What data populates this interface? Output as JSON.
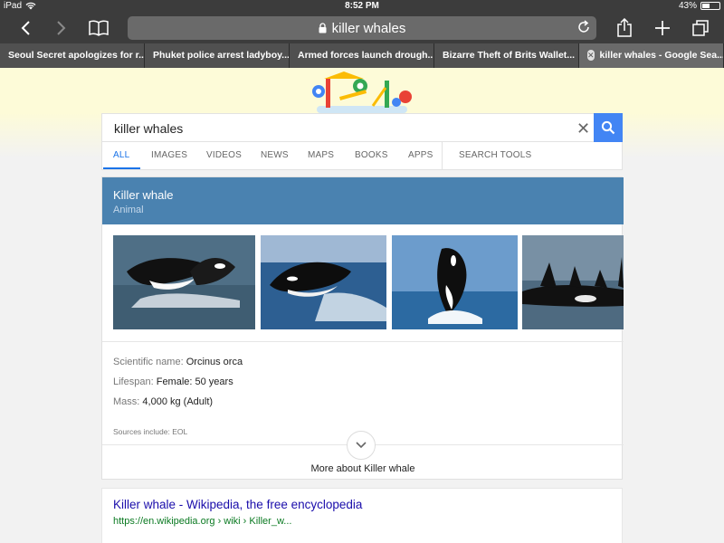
{
  "status": {
    "device": "iPad",
    "time": "8:52 PM",
    "battery": "43%",
    "battery_level": 0.43
  },
  "toolbar": {
    "url_text": "killer whales",
    "icons": [
      "back-icon",
      "forward-icon",
      "bookmarks-icon",
      "lock-icon",
      "reload-icon",
      "share-icon",
      "new-tab-icon",
      "tabs-icon"
    ]
  },
  "tabs": [
    {
      "label": "Seoul Secret apologizes for r..."
    },
    {
      "label": "Phuket police arrest ladyboy..."
    },
    {
      "label": "Armed forces launch drough..."
    },
    {
      "label": "Bizarre Theft of Brits Wallet..."
    },
    {
      "label": "killer whales - Google Sea..."
    }
  ],
  "search": {
    "query": "killer whales"
  },
  "nav": {
    "all": "ALL",
    "images": "IMAGES",
    "videos": "VIDEOS",
    "news": "NEWS",
    "maps": "MAPS",
    "books": "BOOKS",
    "apps": "APPS",
    "tools": "SEARCH TOOLS"
  },
  "knowledge_panel": {
    "title": "Killer whale",
    "subtitle": "Animal",
    "facts": [
      {
        "key": "Scientific name:",
        "value": "Orcinus orca"
      },
      {
        "key": "Lifespan:",
        "value": "Female: 50 years"
      },
      {
        "key": "Mass:",
        "value": "4,000 kg (Adult)"
      }
    ],
    "sources": "Sources include: EOL",
    "more": "More about Killer whale"
  },
  "result": {
    "title": "Killer whale - Wikipedia, the free encyclopedia",
    "url": "https://en.wikipedia.org › wiki › Killer_w..."
  },
  "colors": {
    "accent": "#4285f4",
    "panel_header": "#4a82b0",
    "link": "#1a0dab",
    "url": "#0b7a22"
  }
}
